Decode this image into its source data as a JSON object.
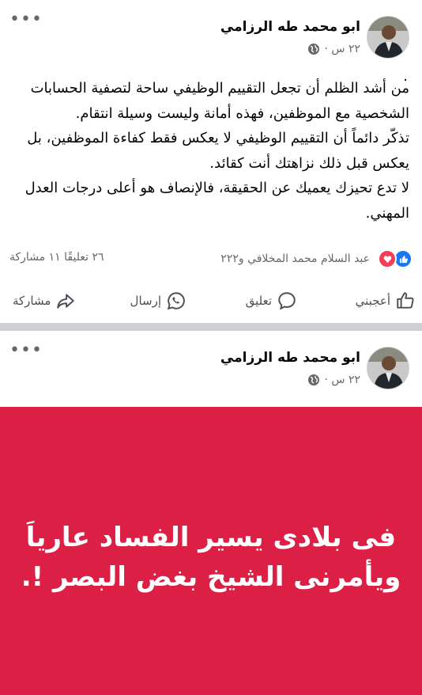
{
  "posts": [
    {
      "author": "ابو محمد طه الرزامي",
      "time": "٢٢ س ·",
      "more_icon": "more-icon",
      "dot_line": ".",
      "text_lines": [
        "من أشد الظلم أن تجعل التقييم الوظيفي ساحة لتصفية الحسابات الشخصية مع الموظفين، فهذه أمانة وليست وسيلة انتقام.",
        "تذكّر دائماً أن التقييم الوظيفي لا يعكس فقط كفاءة الموظفين، بل يعكس قبل ذلك نزاهتك أنت كقائد.",
        "لا تدع تحيزك يعميك عن الحقيقة، فالإنصاف هو أعلى درجات العدل المهني."
      ],
      "reactions_text": "عبد السلام محمد المخلافي و٢٢٢",
      "counts_text": "٢٦ تعليقًا  ١١ مشاركة",
      "actions": {
        "like": "أعجبني",
        "comment": "تعليق",
        "send": "إرسال",
        "share": "مشاركة"
      }
    },
    {
      "author": "ابو محمد طه الرزامي",
      "time": "٢٢ س ·",
      "banner_lines": [
        "فى بلادى يسير الفساد عارياَ",
        "ويأمرنى الشيخ بغض البصر !."
      ],
      "banner_color": "#dc1f44"
    }
  ]
}
